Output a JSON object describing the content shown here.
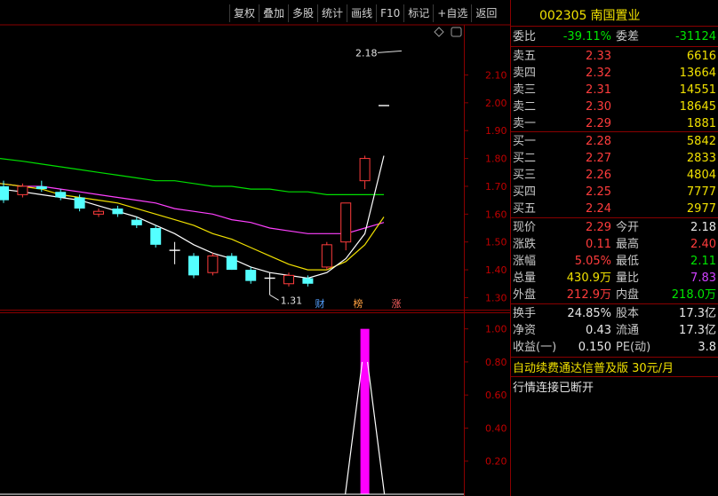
{
  "toolbar": {
    "buttons": [
      "复权",
      "叠加",
      "多股",
      "统计",
      "画线",
      "F10",
      "标记",
      "+自选",
      "返回"
    ]
  },
  "stock": {
    "code": "002305",
    "name": "南国置业"
  },
  "quote": {
    "weibi_label": "委比",
    "weibi": "-39.11%",
    "weicha_label": "委差",
    "weicha": "-31124",
    "asks": [
      {
        "label": "卖五",
        "price": "2.33",
        "vol": "6616"
      },
      {
        "label": "卖四",
        "price": "2.32",
        "vol": "13664"
      },
      {
        "label": "卖三",
        "price": "2.31",
        "vol": "14551"
      },
      {
        "label": "卖二",
        "price": "2.30",
        "vol": "18645"
      },
      {
        "label": "卖一",
        "price": "2.29",
        "vol": "1881"
      }
    ],
    "bids": [
      {
        "label": "买一",
        "price": "2.28",
        "vol": "5842"
      },
      {
        "label": "买二",
        "price": "2.27",
        "vol": "2833"
      },
      {
        "label": "买三",
        "price": "2.26",
        "vol": "4804"
      },
      {
        "label": "买四",
        "price": "2.25",
        "vol": "7777"
      },
      {
        "label": "买五",
        "price": "2.24",
        "vol": "2977"
      }
    ],
    "stats": [
      {
        "l1": "现价",
        "v1": "2.29",
        "c1": "red",
        "l2": "今开",
        "v2": "2.18",
        "c2": "white"
      },
      {
        "l1": "涨跌",
        "v1": "0.11",
        "c1": "red",
        "l2": "最高",
        "v2": "2.40",
        "c2": "red"
      },
      {
        "l1": "涨幅",
        "v1": "5.05%",
        "c1": "red",
        "l2": "最低",
        "v2": "2.11",
        "c2": "green"
      },
      {
        "l1": "总量",
        "v1": "430.9万",
        "c1": "yellow",
        "l2": "量比",
        "v2": "7.83",
        "c2": "purple"
      },
      {
        "l1": "外盘",
        "v1": "212.9万",
        "c1": "red",
        "l2": "内盘",
        "v2": "218.0万",
        "c2": "green"
      }
    ],
    "fundamentals": [
      {
        "l1": "换手",
        "v1": "24.85%",
        "l2": "股本",
        "v2": "17.3亿"
      },
      {
        "l1": "净资",
        "v1": "0.43",
        "l2": "流通",
        "v2": "17.3亿"
      },
      {
        "l1": "收益(一)",
        "v1": "0.150",
        "l2": "PE(动)",
        "v2": "3.8"
      }
    ],
    "notice": "自动续费通达信普及版  30元/月",
    "status": "行情连接已断开"
  },
  "colors": {
    "up": "#ff3c3c",
    "down": "#54ffff",
    "ma5": "#ffffff",
    "ma10": "#f0e000",
    "ma20": "#ff40ff",
    "ma60": "#00e000",
    "grid": "#8a0000",
    "vol": "#ff00ff"
  },
  "chart_data": [
    {
      "type": "candlestick",
      "ylim": [
        1.26,
        2.28
      ],
      "yticks": [
        "1.30",
        "1.40",
        "1.50",
        "1.60",
        "1.70",
        "1.80",
        "1.90",
        "2.00",
        "2.10"
      ],
      "annotations": {
        "high_label": "2.18",
        "low_label": "1.31"
      },
      "markers": [
        "财",
        "榜",
        "涨"
      ],
      "candles": [
        {
          "o": 1.7,
          "c": 1.65,
          "h": 1.72,
          "l": 1.64
        },
        {
          "o": 1.67,
          "c": 1.7,
          "h": 1.71,
          "l": 1.66
        },
        {
          "o": 1.7,
          "c": 1.69,
          "h": 1.72,
          "l": 1.68
        },
        {
          "o": 1.68,
          "c": 1.66,
          "h": 1.69,
          "l": 1.65
        },
        {
          "o": 1.66,
          "c": 1.62,
          "h": 1.67,
          "l": 1.61
        },
        {
          "o": 1.6,
          "c": 1.61,
          "h": 1.62,
          "l": 1.59
        },
        {
          "o": 1.62,
          "c": 1.6,
          "h": 1.63,
          "l": 1.59
        },
        {
          "o": 1.58,
          "c": 1.56,
          "h": 1.59,
          "l": 1.55
        },
        {
          "o": 1.55,
          "c": 1.49,
          "h": 1.56,
          "l": 1.48
        },
        {
          "o": 1.47,
          "c": 1.47,
          "h": 1.5,
          "l": 1.42
        },
        {
          "o": 1.45,
          "c": 1.38,
          "h": 1.46,
          "l": 1.37
        },
        {
          "o": 1.39,
          "c": 1.45,
          "h": 1.46,
          "l": 1.38
        },
        {
          "o": 1.45,
          "c": 1.4,
          "h": 1.46,
          "l": 1.4
        },
        {
          "o": 1.4,
          "c": 1.36,
          "h": 1.41,
          "l": 1.35
        },
        {
          "o": 1.37,
          "c": 1.37,
          "h": 1.39,
          "l": 1.31
        },
        {
          "o": 1.35,
          "c": 1.38,
          "h": 1.39,
          "l": 1.34
        },
        {
          "o": 1.37,
          "c": 1.35,
          "h": 1.38,
          "l": 1.34
        },
        {
          "o": 1.41,
          "c": 1.49,
          "h": 1.5,
          "l": 1.4
        },
        {
          "o": 1.5,
          "c": 1.64,
          "h": 1.64,
          "l": 1.47
        },
        {
          "o": 1.72,
          "c": 1.8,
          "h": 1.81,
          "l": 1.69
        },
        {
          "o": 1.99,
          "c": 1.99,
          "h": 1.99,
          "l": 1.99
        }
      ],
      "ma5": [
        1.69,
        1.68,
        1.67,
        1.66,
        1.65,
        1.63,
        1.61,
        1.59,
        1.56,
        1.53,
        1.49,
        1.46,
        1.44,
        1.41,
        1.39,
        1.38,
        1.37,
        1.39,
        1.44,
        1.53,
        1.81
      ],
      "ma10": [
        1.71,
        1.7,
        1.69,
        1.67,
        1.66,
        1.65,
        1.64,
        1.62,
        1.6,
        1.58,
        1.56,
        1.53,
        1.51,
        1.48,
        1.45,
        1.42,
        1.4,
        1.4,
        1.43,
        1.49,
        1.59
      ],
      "ma20": [
        1.71,
        1.7,
        1.7,
        1.69,
        1.68,
        1.67,
        1.66,
        1.65,
        1.64,
        1.62,
        1.61,
        1.6,
        1.58,
        1.57,
        1.55,
        1.54,
        1.53,
        1.53,
        1.53,
        1.55,
        1.57
      ],
      "ma60": [
        1.8,
        1.79,
        1.78,
        1.77,
        1.76,
        1.75,
        1.74,
        1.73,
        1.72,
        1.72,
        1.71,
        1.7,
        1.7,
        1.69,
        1.69,
        1.68,
        1.68,
        1.67,
        1.67,
        1.67,
        1.67
      ]
    },
    {
      "type": "bar",
      "ylim": [
        0.0,
        1.1
      ],
      "yticks": [
        "0.20",
        "0.40",
        "0.60",
        "0.80",
        "1.00"
      ],
      "values": [
        0,
        0,
        0,
        0,
        0,
        0,
        0,
        0,
        0,
        0,
        0,
        0,
        0,
        0,
        0,
        0,
        0,
        0,
        0,
        1.0,
        0
      ]
    }
  ]
}
